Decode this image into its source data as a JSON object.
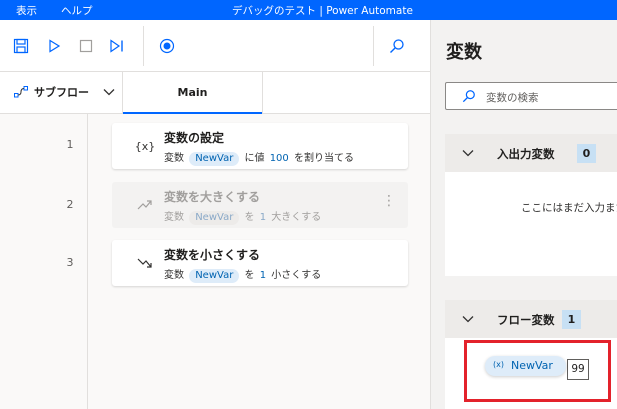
{
  "titlebar": {
    "menu": [
      "表示",
      "ヘルプ"
    ],
    "title": "デバッグのテスト | Power Automate"
  },
  "toolbar": {
    "buttons": [
      "save-icon",
      "run-icon",
      "stop-icon",
      "run-next-icon",
      "record-icon",
      "search-icon"
    ]
  },
  "subbar": {
    "subflow_label": "サブフロー",
    "main_tab": "Main"
  },
  "actions": [
    {
      "line": "1",
      "icon": "{x}",
      "title": "変数の設定",
      "desc_prefix": "変数",
      "var": "NewVar",
      "desc_mid": "に値",
      "value": "100",
      "desc_suffix": "を割り当てる",
      "disabled": false
    },
    {
      "line": "2",
      "icon": "increase-icon",
      "title": "変数を大きくする",
      "desc_prefix": "変数",
      "var": "NewVar",
      "desc_mid": "を",
      "value": "1",
      "desc_suffix": "大きくする",
      "disabled": true
    },
    {
      "line": "3",
      "icon": "decrease-icon",
      "title": "変数を小さくする",
      "desc_prefix": "変数",
      "var": "NewVar",
      "desc_mid": "を",
      "value": "1",
      "desc_suffix": "小さくする",
      "disabled": false
    }
  ],
  "variables_panel": {
    "title": "変数",
    "search_placeholder": "変数の検索",
    "io_section": {
      "title": "入出力変数",
      "count": "0",
      "empty_text": "ここにはまだ入力また"
    },
    "flow_section": {
      "title": "フロー変数",
      "count": "1"
    },
    "flow_var": {
      "icon": "(x)",
      "name": "NewVar",
      "value": "99"
    }
  },
  "colors": {
    "accent": "#0066ff",
    "highlight": "#e3222b"
  }
}
